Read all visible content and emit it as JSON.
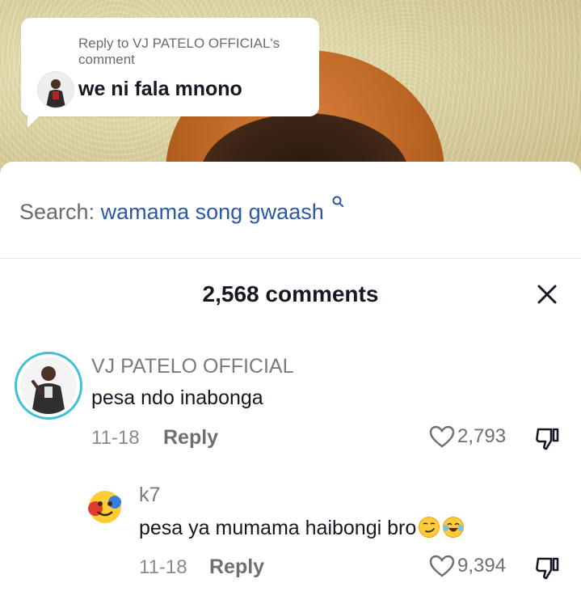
{
  "reply_bubble": {
    "reply_to": "Reply to VJ PATELO OFFICIAL's comment",
    "text": "we ni fala mnono"
  },
  "search": {
    "label": "Search:",
    "term": "wamama song gwaash",
    "icon": "search-icon"
  },
  "comments_header": {
    "count_label": "2,568 comments",
    "close_icon": "close-icon"
  },
  "comments": [
    {
      "username": "VJ PATELO OFFICIAL",
      "text": "pesa ndo inabonga",
      "date": "11-18",
      "reply_label": "Reply",
      "likes": "2,793",
      "avatar_ring_color": "#3fc1d8"
    },
    {
      "username": "k7",
      "text": "pesa ya mumama haibongi bro",
      "emojis": [
        "smirk-emoji",
        "tears-of-joy-emoji"
      ],
      "date": "11-18",
      "reply_label": "Reply",
      "likes": "9,394"
    }
  ],
  "colors": {
    "search_term": "#2c58a8",
    "text_primary": "#161823",
    "text_secondary": "#7a7a7a"
  }
}
